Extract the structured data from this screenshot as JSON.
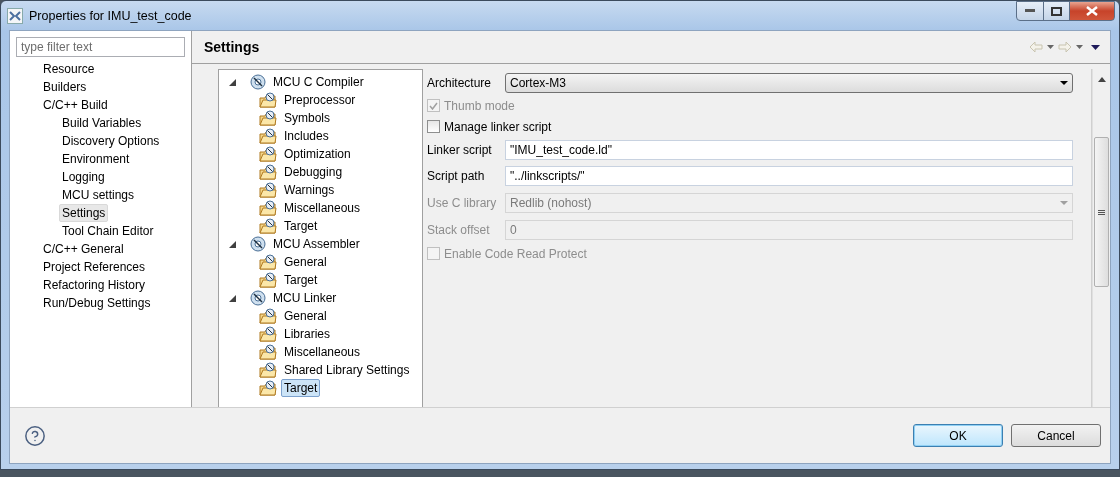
{
  "window": {
    "title": "Properties for IMU_test_code"
  },
  "filter": {
    "placeholder": "type filter text"
  },
  "nav_tree": [
    {
      "label": "Resource",
      "selected": false
    },
    {
      "label": "Builders",
      "selected": false
    },
    {
      "label": "C/C++ Build",
      "selected": false,
      "children": [
        {
          "label": "Build Variables",
          "selected": false
        },
        {
          "label": "Discovery Options",
          "selected": false
        },
        {
          "label": "Environment",
          "selected": false
        },
        {
          "label": "Logging",
          "selected": false
        },
        {
          "label": "MCU settings",
          "selected": false
        },
        {
          "label": "Settings",
          "selected": true
        },
        {
          "label": "Tool Chain Editor",
          "selected": false
        }
      ]
    },
    {
      "label": "C/C++ General",
      "selected": false
    },
    {
      "label": "Project References",
      "selected": false
    },
    {
      "label": "Refactoring History",
      "selected": false
    },
    {
      "label": "Run/Debug Settings",
      "selected": false
    }
  ],
  "page": {
    "title": "Settings"
  },
  "tool_tree": [
    {
      "label": "MCU C Compiler",
      "expanded": true,
      "children": [
        {
          "label": "Preprocessor",
          "selected": false
        },
        {
          "label": "Symbols",
          "selected": false
        },
        {
          "label": "Includes",
          "selected": false
        },
        {
          "label": "Optimization",
          "selected": false
        },
        {
          "label": "Debugging",
          "selected": false
        },
        {
          "label": "Warnings",
          "selected": false
        },
        {
          "label": "Miscellaneous",
          "selected": false
        },
        {
          "label": "Target",
          "selected": false
        }
      ]
    },
    {
      "label": "MCU Assembler",
      "expanded": true,
      "children": [
        {
          "label": "General",
          "selected": false
        },
        {
          "label": "Target",
          "selected": false
        }
      ]
    },
    {
      "label": "MCU Linker",
      "expanded": true,
      "children": [
        {
          "label": "General",
          "selected": false
        },
        {
          "label": "Libraries",
          "selected": false
        },
        {
          "label": "Miscellaneous",
          "selected": false
        },
        {
          "label": "Shared Library Settings",
          "selected": false
        },
        {
          "label": "Target",
          "selected": true
        }
      ]
    }
  ],
  "form": [
    {
      "kind": "select",
      "label": "Architecture",
      "value": "Cortex-M3",
      "disabled": false
    },
    {
      "kind": "checkbox",
      "label": "Thumb mode",
      "checked": true,
      "disabled": true
    },
    {
      "kind": "checkbox",
      "label": "Manage linker script",
      "checked": false,
      "disabled": false
    },
    {
      "kind": "text",
      "label": "Linker script",
      "value": "\"IMU_test_code.ld\"",
      "disabled": false
    },
    {
      "kind": "text",
      "label": "Script path",
      "value": "\"../linkscripts/\"",
      "disabled": false
    },
    {
      "kind": "select",
      "label": "Use C library",
      "value": "Redlib (nohost)",
      "disabled": true
    },
    {
      "kind": "text",
      "label": "Stack offset",
      "value": "0",
      "disabled": true
    },
    {
      "kind": "checkbox",
      "label": "Enable Code Read Protect",
      "checked": false,
      "disabled": true
    }
  ],
  "buttons": [
    {
      "label": "OK",
      "default": true
    },
    {
      "label": "Cancel",
      "default": false
    }
  ]
}
